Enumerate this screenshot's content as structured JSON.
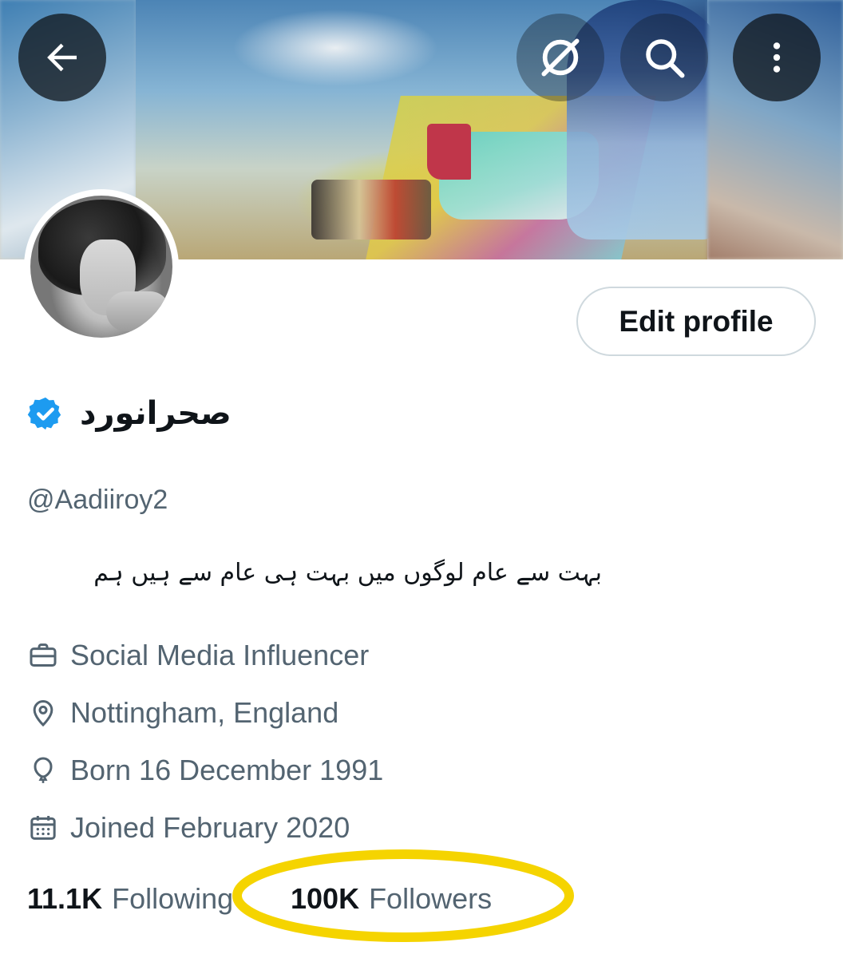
{
  "profile": {
    "display_name": "صحرانورد",
    "handle": "@Aadiiroy2",
    "bio": "بہت سے عام لوگوں میں  بہت ہی عام سے ہیں ہم",
    "edit_profile_label": "Edit profile",
    "profession": "Social Media Influencer",
    "location": "Nottingham, England",
    "birthday": "Born 16 December 1991",
    "joined": "Joined February 2020"
  },
  "stats": {
    "following_count": "11.1K",
    "following_label": "Following",
    "followers_count": "100K",
    "followers_label": "Followers"
  },
  "header": {
    "icons": [
      "back-arrow-icon",
      "grok-icon",
      "search-icon",
      "more-vertical-icon"
    ]
  },
  "colors": {
    "verified_blue": "#1d9bf0",
    "secondary_text": "#536471",
    "highlight_yellow": "#f5d400"
  }
}
